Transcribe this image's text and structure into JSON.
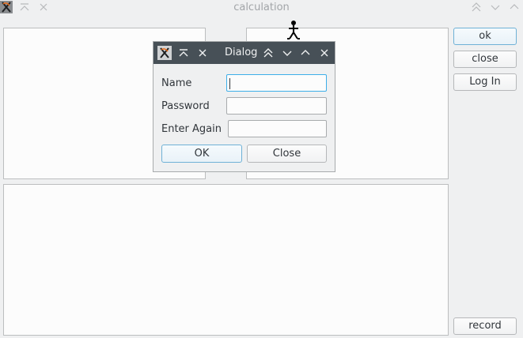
{
  "window": {
    "title": "calculation",
    "buttons": {
      "ok": "ok",
      "close": "close",
      "login": "Log In",
      "record": "record"
    }
  },
  "dialog": {
    "title": "Dialog",
    "fields": {
      "name_label": "Name",
      "name_value": "",
      "password_label": "Password",
      "password_value": "",
      "enter_again_label": "Enter Again",
      "enter_again_value": ""
    },
    "buttons": {
      "ok": "OK",
      "close": "Close"
    }
  },
  "colors": {
    "accent": "#3daee9",
    "dialog_titlebar": "#475057",
    "window_bg": "#eff0f1"
  }
}
